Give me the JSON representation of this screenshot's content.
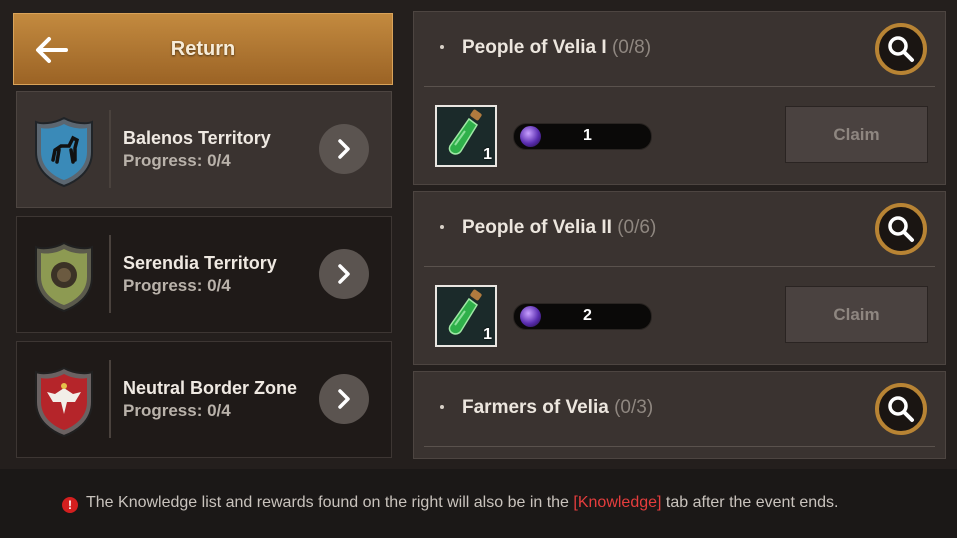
{
  "return_button": {
    "label": "Return"
  },
  "territories": [
    {
      "name": "Balenos Territory",
      "progress": "Progress: 0/4",
      "crest": "horse-crest-icon",
      "color": "#3a8ab8"
    },
    {
      "name": "Serendia Territory",
      "progress": "Progress: 0/4",
      "crest": "lion-crest-icon",
      "color": "#8d9a52"
    },
    {
      "name": "Neutral Border Zone",
      "progress": "Progress: 0/4",
      "crest": "eagle-crest-icon",
      "color": "#b5252a"
    }
  ],
  "quests": [
    {
      "title": "People of Velia I",
      "count": "(0/8)",
      "item_qty": "1",
      "reward_value": "1",
      "claim_label": "Claim"
    },
    {
      "title": "People of Velia II",
      "count": "(0/6)",
      "item_qty": "1",
      "reward_value": "2",
      "claim_label": "Claim"
    },
    {
      "title": "Farmers of Velia",
      "count": "(0/3)"
    }
  ],
  "footer": {
    "warn_icon": "!",
    "note_before": "The Knowledge list and rewards found on the right will also be in the ",
    "note_link": "[Knowledge]",
    "note_after": " tab after the event ends."
  },
  "colors": {
    "accent": "#b88434",
    "link": "#e53d3d",
    "warning": "#d41f1f"
  }
}
